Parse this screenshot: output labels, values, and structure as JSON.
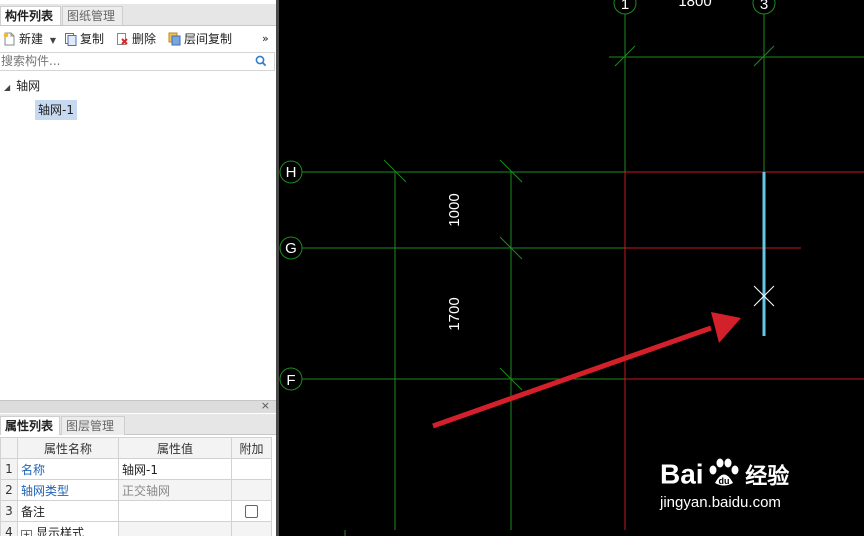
{
  "component_panel": {
    "tabs": [
      {
        "label": "构件列表",
        "active": true
      },
      {
        "label": "图纸管理",
        "active": false
      }
    ],
    "toolbar": {
      "new_label": "新建",
      "copy_label": "复制",
      "delete_label": "删除",
      "floor_copy_label": "层间复制",
      "more_label": "»"
    },
    "search": {
      "placeholder": "搜索构件..."
    },
    "tree": {
      "root_label": "轴网",
      "child_label": "轴网-1"
    }
  },
  "property_panel": {
    "close_label": "×",
    "tabs": [
      {
        "label": "属性列表",
        "active": true
      },
      {
        "label": "图层管理",
        "active": false
      }
    ],
    "columns": [
      "属性名称",
      "属性值",
      "附加"
    ],
    "rows": [
      {
        "num": "1",
        "name": "名称",
        "value": "轴网-1"
      },
      {
        "num": "2",
        "name": "轴网类型",
        "value": "正交轴网"
      },
      {
        "num": "3",
        "name": "备注",
        "value": ""
      },
      {
        "num": "4",
        "name": "显示样式",
        "value": ""
      }
    ],
    "expand_label": "+"
  },
  "canvas": {
    "axis_labels": {
      "top_left": "1",
      "top_right": "3",
      "row_h": "H",
      "row_g": "G",
      "row_f": "F"
    },
    "dimensions": {
      "top": "1800",
      "upper": "1000",
      "lower": "1700"
    },
    "colors": {
      "grid": "#1e8a1e",
      "selected_axis": "#c8161e",
      "highlight": "#66c8e8",
      "arrow": "#d4202a"
    }
  },
  "watermark": {
    "brand_left": "Bai",
    "brand_right": "经验",
    "url": "jingyan.baidu.com"
  }
}
